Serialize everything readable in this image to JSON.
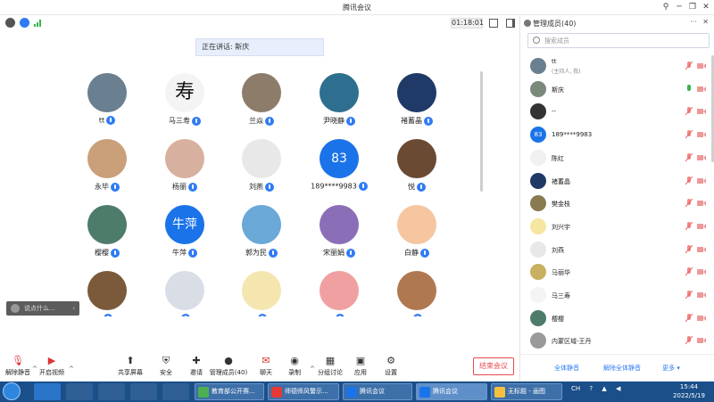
{
  "window": {
    "title": "腾讯会议"
  },
  "timer": "01:18:01",
  "speaking": {
    "label": "正在讲话: 斯庆"
  },
  "grid": {
    "participants": [
      {
        "name": "tt",
        "color": "#6a7f8f",
        "glyph": ""
      },
      {
        "name": "马三寿",
        "color": "#f4f4f4",
        "glyph": "寿"
      },
      {
        "name": "兰焱",
        "color": "#8d7c6a",
        "glyph": ""
      },
      {
        "name": "尹晓静",
        "color": "#2e6e8e",
        "glyph": ""
      },
      {
        "name": "褚蓄晶",
        "color": "#1f3a66",
        "glyph": ""
      },
      {
        "name": "永毕",
        "color": "#c9a07a",
        "glyph": ""
      },
      {
        "name": "杨丽",
        "color": "#d8b0a0",
        "glyph": ""
      },
      {
        "name": "刘燕",
        "color": "#e8e8e8",
        "glyph": ""
      },
      {
        "name": "189****9983",
        "color": "#1a73e8",
        "glyph": "83"
      },
      {
        "name": "悦",
        "color": "#6b4a34",
        "glyph": ""
      },
      {
        "name": "樱樱",
        "color": "#4d7c6a",
        "glyph": ""
      },
      {
        "name": "牛萍",
        "color": "#1a73e8",
        "glyph": "牛萍"
      },
      {
        "name": "郭为民",
        "color": "#6aa8d8",
        "glyph": ""
      },
      {
        "name": "宋丽娟",
        "color": "#8a6fb8",
        "glyph": ""
      },
      {
        "name": "白静",
        "color": "#f5c6a0",
        "glyph": ""
      },
      {
        "name": "",
        "color": "#7a5a3a",
        "glyph": ""
      },
      {
        "name": "",
        "color": "#d9dee6",
        "glyph": ""
      },
      {
        "name": "",
        "color": "#f5e6b0",
        "glyph": ""
      },
      {
        "name": "",
        "color": "#f0a0a0",
        "glyph": ""
      },
      {
        "name": "",
        "color": "#b07850",
        "glyph": ""
      }
    ]
  },
  "chatbox": {
    "placeholder": "说点什么..."
  },
  "toolbar": {
    "items": [
      {
        "label": "解除静音",
        "icon": "mic-icon",
        "glyph": "🎙"
      },
      {
        "label": "开启视频",
        "icon": "camera-icon",
        "glyph": "▶"
      },
      {
        "label": "共享屏幕",
        "icon": "share-screen-icon",
        "glyph": "⬆"
      },
      {
        "label": "安全",
        "icon": "shield-icon",
        "glyph": "⛨"
      },
      {
        "label": "邀请",
        "icon": "invite-icon",
        "glyph": "✚"
      },
      {
        "label": "管理成员(40)",
        "icon": "members-icon",
        "glyph": "●"
      },
      {
        "label": "聊天",
        "icon": "chat-icon",
        "glyph": "✉"
      },
      {
        "label": "录制",
        "icon": "record-icon",
        "glyph": "◉"
      },
      {
        "label": "分组讨论",
        "icon": "breakout-icon",
        "glyph": "▦"
      },
      {
        "label": "应用",
        "icon": "apps-icon",
        "glyph": "▣"
      },
      {
        "label": "设置",
        "icon": "settings-icon",
        "glyph": "⚙"
      }
    ],
    "end_label": "结束会议"
  },
  "panel": {
    "title": "管理成员(40)",
    "search_placeholder": "搜索成员",
    "members": [
      {
        "name": "tt",
        "sub": "(主持人, 我)",
        "color": "#6a7f8f",
        "glyph": "",
        "mic": "muted"
      },
      {
        "name": "斯庆",
        "sub": "",
        "color": "#7a8a7a",
        "glyph": "",
        "mic": "on"
      },
      {
        "name": "--",
        "sub": "",
        "color": "#333333",
        "glyph": "",
        "mic": "muted"
      },
      {
        "name": "189****9983",
        "sub": "",
        "color": "#1a73e8",
        "glyph": "83",
        "mic": "muted"
      },
      {
        "name": "陈红",
        "sub": "",
        "color": "#f0f0f0",
        "glyph": "",
        "mic": "muted"
      },
      {
        "name": "褚蓄晶",
        "sub": "",
        "color": "#1f3a66",
        "glyph": "",
        "mic": "muted"
      },
      {
        "name": "樊金枝",
        "sub": "",
        "color": "#8a7a50",
        "glyph": "",
        "mic": "muted"
      },
      {
        "name": "刘兴宇",
        "sub": "",
        "color": "#f5e6a0",
        "glyph": "",
        "mic": "muted"
      },
      {
        "name": "刘燕",
        "sub": "",
        "color": "#e8e8e8",
        "glyph": "",
        "mic": "muted"
      },
      {
        "name": "马丽华",
        "sub": "",
        "color": "#c8b060",
        "glyph": "",
        "mic": "muted"
      },
      {
        "name": "马三寿",
        "sub": "",
        "color": "#f4f4f4",
        "glyph": "",
        "mic": "muted"
      },
      {
        "name": "樱樱",
        "sub": "",
        "color": "#4d7c6a",
        "glyph": "",
        "mic": "muted"
      },
      {
        "name": "内蒙区域-王丹",
        "sub": "",
        "color": "#9a9a9a",
        "glyph": "",
        "mic": "muted"
      }
    ],
    "mute_all": "全体静音",
    "unmute_all": "解除全体静音",
    "more": "更多 ▾"
  },
  "taskbar": {
    "tasks": [
      {
        "label": "教育部公开赛...",
        "color": "#4caf50"
      },
      {
        "label": "师德师风警示...",
        "color": "#e53935"
      },
      {
        "label": "腾讯会议",
        "color": "#1a73e8"
      },
      {
        "label": "腾讯会议",
        "color": "#1a73e8"
      },
      {
        "label": "无标题 - 画图",
        "color": "#f5c040"
      }
    ],
    "tray": "CH",
    "time": "15:44",
    "date": "2022/5/19"
  }
}
